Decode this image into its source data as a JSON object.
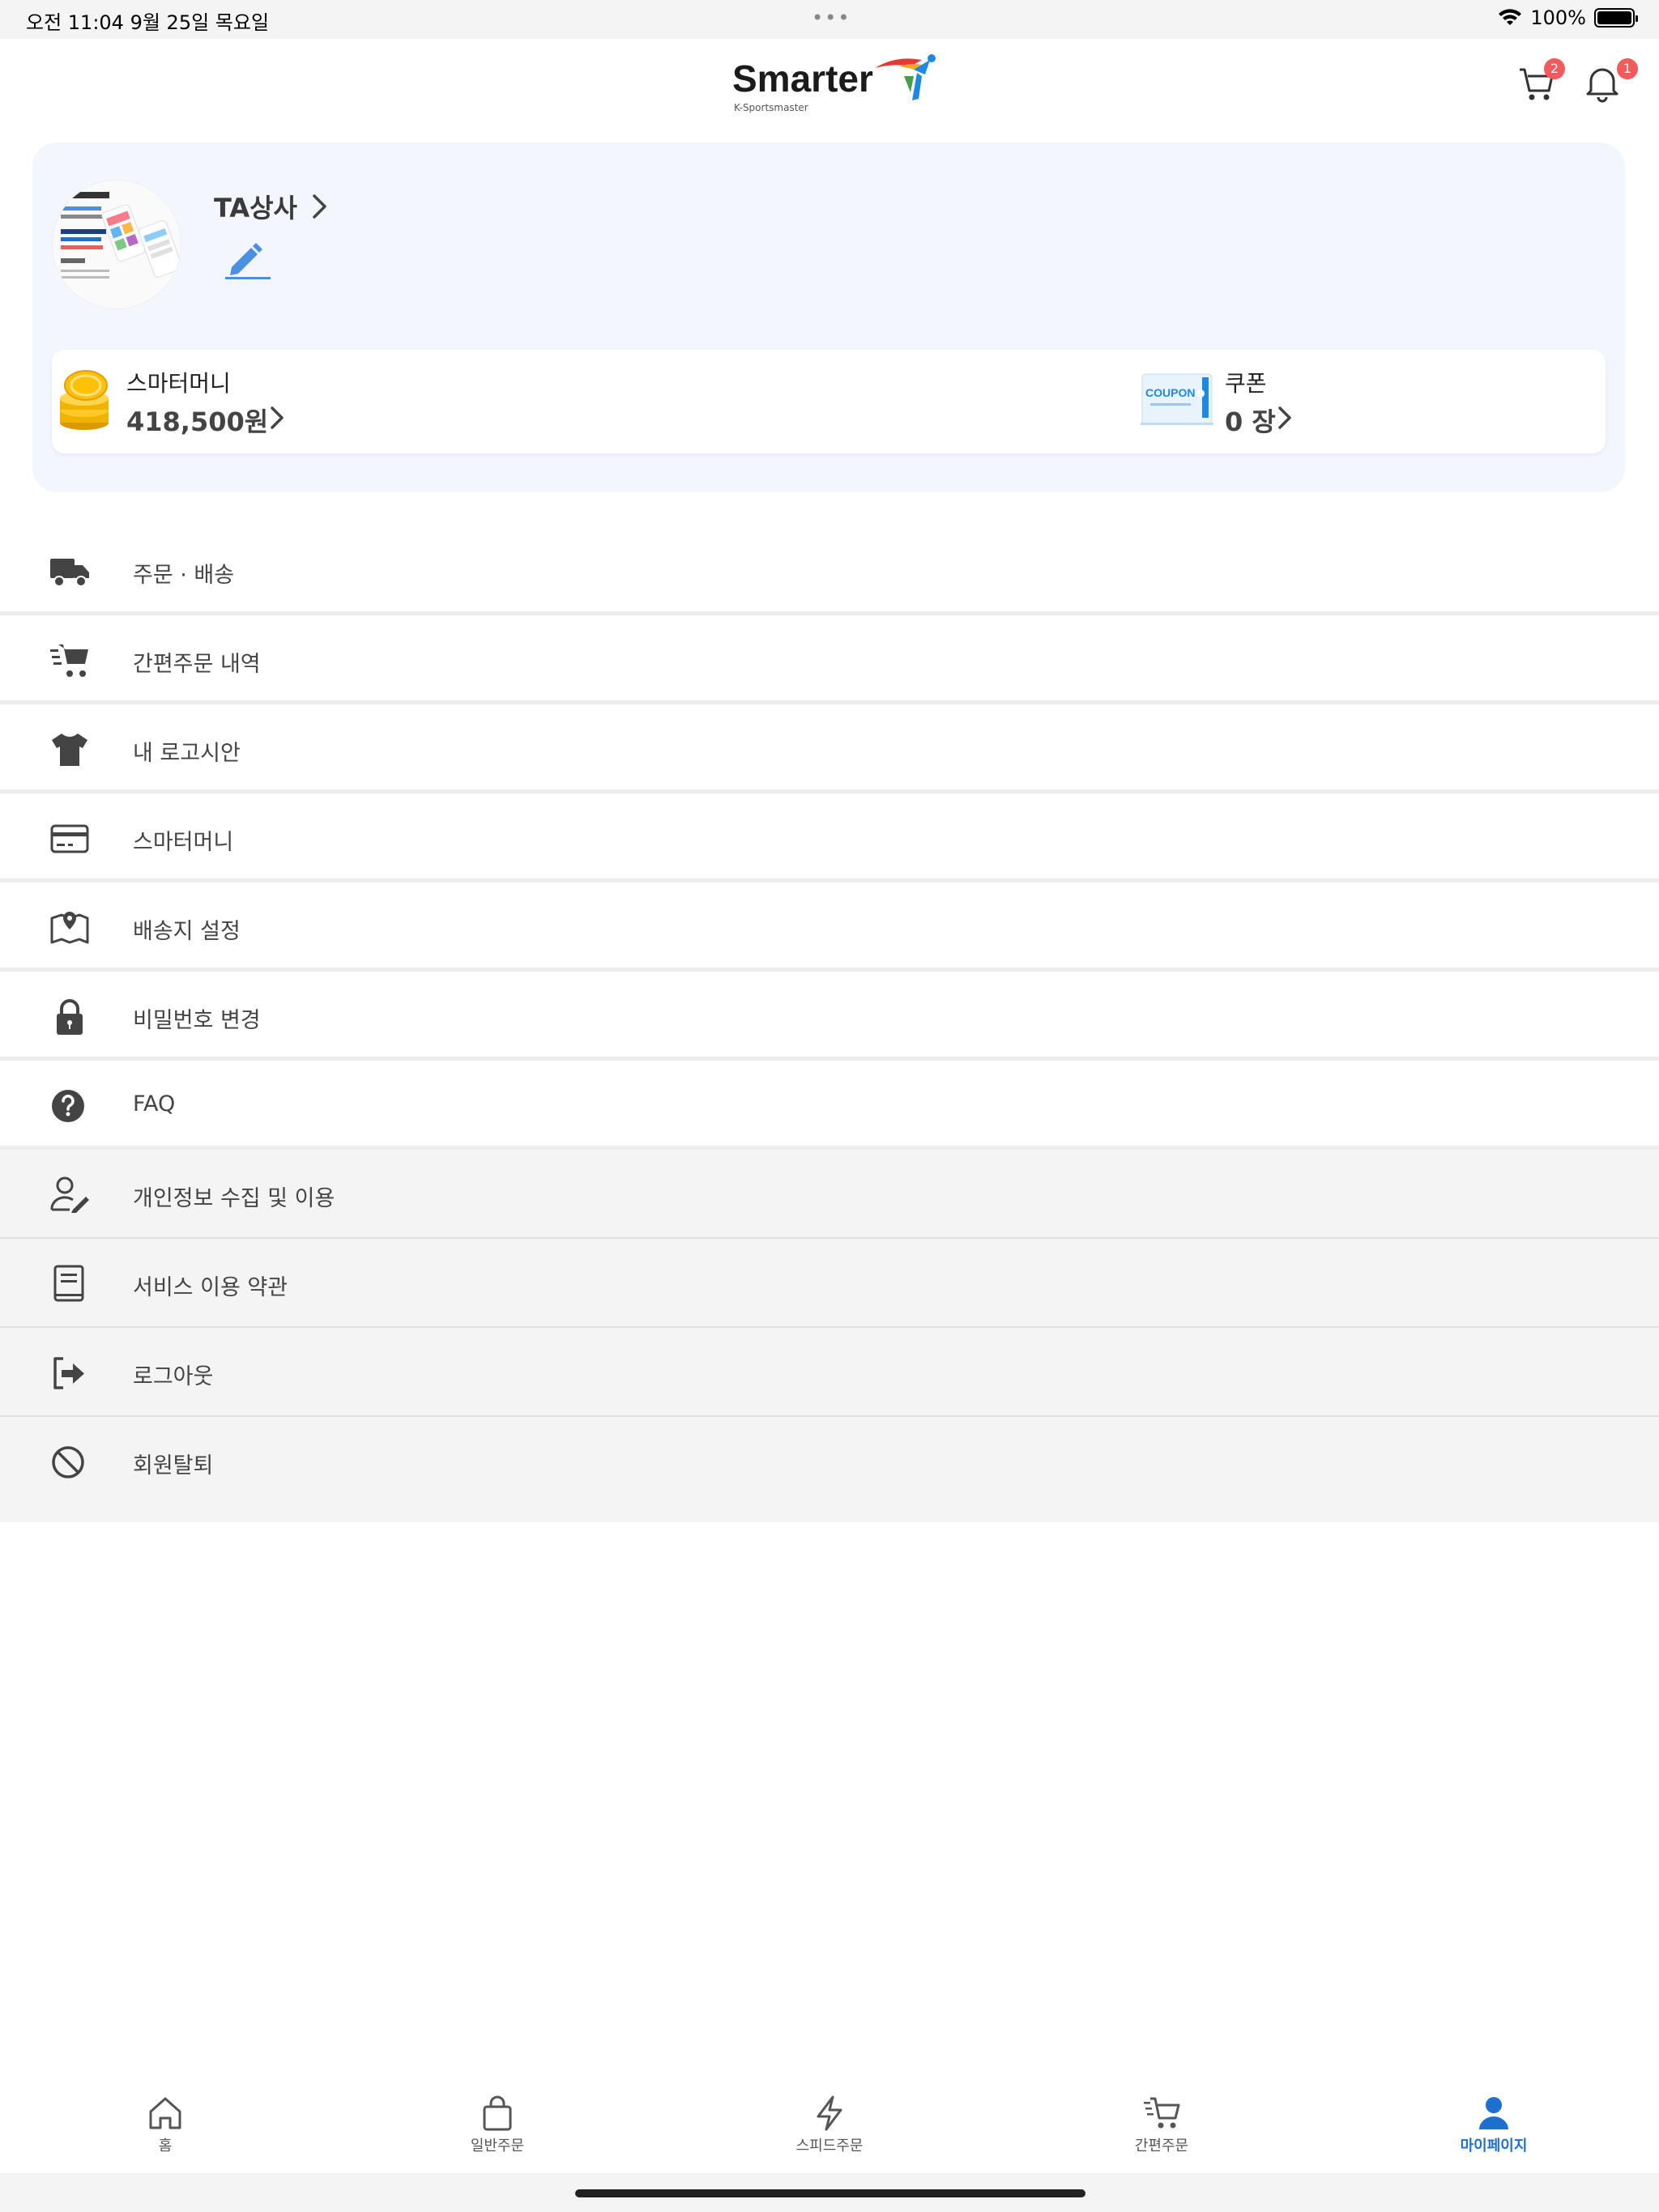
{
  "status_bar": {
    "time": "오전 11:04   9월 25일 목요일",
    "dots": "•••",
    "battery": "100%"
  },
  "header": {
    "logo_text": "Smarter",
    "logo_sub": "K-Sportsmaster",
    "cart_count": "2",
    "notification_count": "1"
  },
  "profile": {
    "name": "TA상사"
  },
  "wallet": {
    "money_label": "스마터머니",
    "money_value": "418,500원",
    "coupon_label": "쿠폰",
    "coupon_value": "0 장",
    "coupon_image_text": "COUPON"
  },
  "menu": {
    "items": [
      {
        "label": "주문 · 배송",
        "icon": "truck-icon"
      },
      {
        "label": "간편주문 내역",
        "icon": "fast-cart-icon"
      },
      {
        "label": "내 로고시안",
        "icon": "tshirt-icon"
      },
      {
        "label": "스마터머니",
        "icon": "card-icon"
      },
      {
        "label": "배송지 설정",
        "icon": "map-icon"
      },
      {
        "label": "비밀번호 변경",
        "icon": "lock-icon"
      },
      {
        "label": "FAQ",
        "icon": "question-icon"
      },
      {
        "label": "개인정보 수집 및 이용",
        "icon": "user-edit-icon"
      },
      {
        "label": "서비스 이용 약관",
        "icon": "book-icon"
      },
      {
        "label": "로그아웃",
        "icon": "logout-icon"
      },
      {
        "label": "회원탈퇴",
        "icon": "ban-icon"
      }
    ]
  },
  "bottom_nav": {
    "items": [
      {
        "label": "홈",
        "icon": "home-icon"
      },
      {
        "label": "일반주문",
        "icon": "bag-icon"
      },
      {
        "label": "스피드주문",
        "icon": "bolt-icon"
      },
      {
        "label": "간편주문",
        "icon": "cart-icon"
      },
      {
        "label": "마이페이지",
        "icon": "person-icon"
      }
    ],
    "active_index": 4
  },
  "colors": {
    "accent": "#1f6fd1",
    "badge": "#f15b5b",
    "card_bg": "#f3f7fd",
    "gray_row": "#f4f4f4"
  }
}
